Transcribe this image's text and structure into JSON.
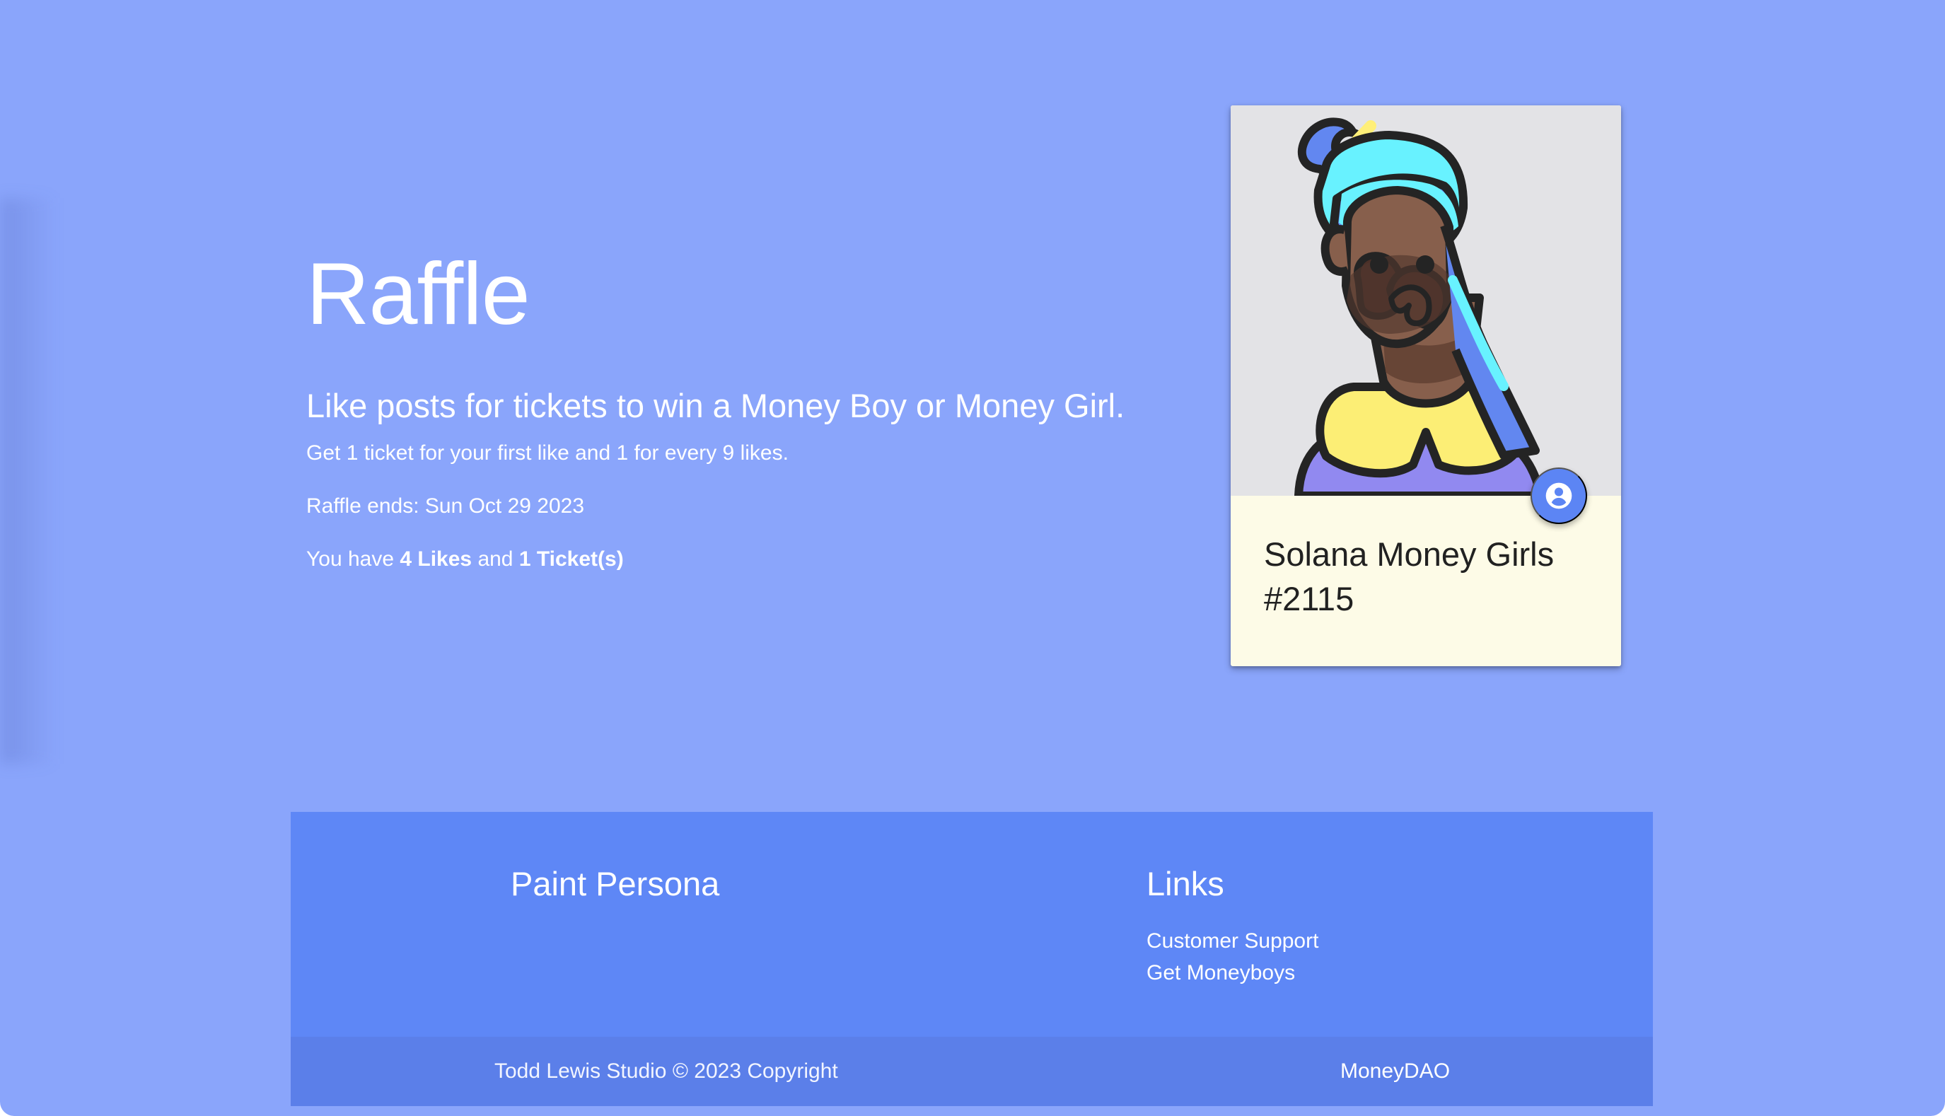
{
  "hero": {
    "title": "Raffle",
    "subtitle": "Like posts for tickets to win a Money Boy or Money Girl.",
    "rule_text": "Get 1 ticket for your first like and 1 for every 9 likes.",
    "ends_text": "Raffle ends: Sun Oct 29 2023",
    "status": {
      "prefix": "You have",
      "likes": "4 Likes",
      "joiner": "and",
      "tickets": "1 Ticket(s)"
    }
  },
  "card": {
    "title": "Solana Money Girls #2115",
    "image_icon": "nft-avatar-image",
    "action_icon": "account-circle-icon"
  },
  "footer": {
    "brand": "Paint Persona",
    "links_title": "Links",
    "links": [
      {
        "label": "Customer Support"
      },
      {
        "label": "Get Moneyboys"
      }
    ],
    "copyright": "Todd Lewis Studio © 2023 Copyright",
    "dao_link": "MoneyDAO"
  },
  "colors": {
    "page_background": "#8aa5fb",
    "footer_background": "#5e87f6",
    "footer_bottom_background": "#5b7fe9",
    "card_background": "#fdfbe7",
    "card_image_background": "#e3e3e6",
    "fab_background": "#5c85f4",
    "text_light": "#ffffff",
    "text_dark": "#212121"
  }
}
